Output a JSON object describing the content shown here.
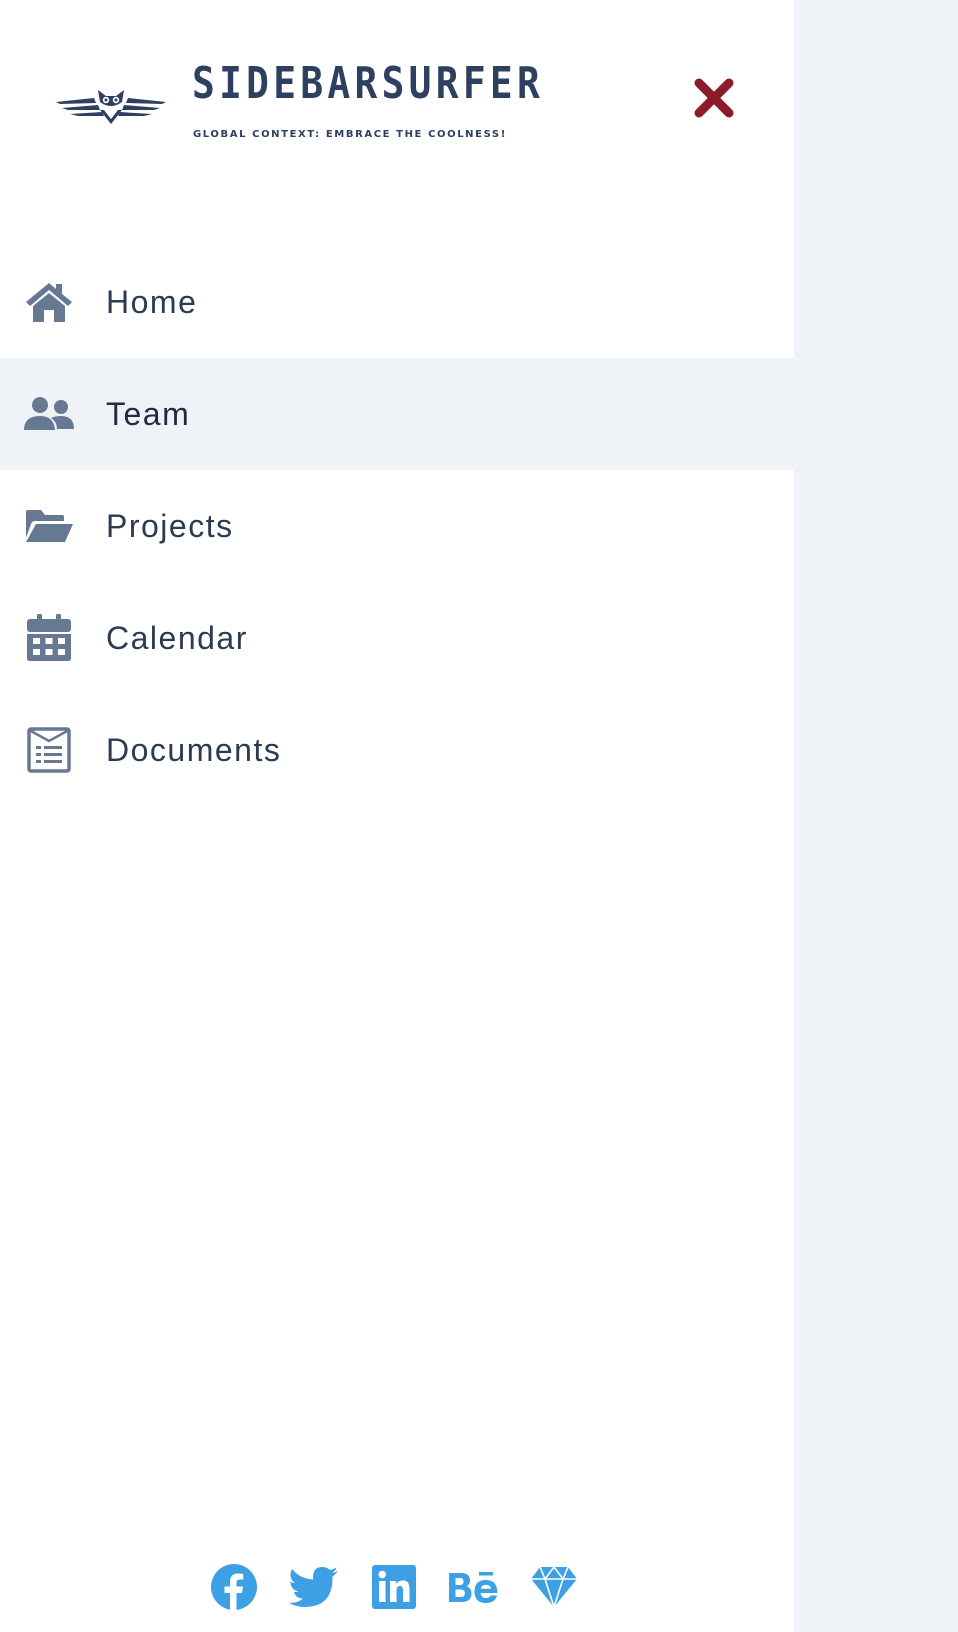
{
  "brand": {
    "name": "SIDEBARSURFER",
    "tagline": "GLOBAL CONTEXT: EMBRACE THE COOLNESS!",
    "logo_icon": "owl-wings-logo"
  },
  "close_icon": "close-icon",
  "nav": {
    "items": [
      {
        "label": "Home",
        "icon": "home-icon",
        "active": false
      },
      {
        "label": "Team",
        "icon": "users-icon",
        "active": true
      },
      {
        "label": "Projects",
        "icon": "folder-open-icon",
        "active": false
      },
      {
        "label": "Calendar",
        "icon": "calendar-icon",
        "active": false
      },
      {
        "label": "Documents",
        "icon": "document-icon",
        "active": false
      }
    ]
  },
  "social": [
    {
      "name": "facebook-icon"
    },
    {
      "name": "twitter-icon"
    },
    {
      "name": "linkedin-icon"
    },
    {
      "name": "behance-icon"
    },
    {
      "name": "sketch-icon"
    }
  ],
  "colors": {
    "text": "#2c3a52",
    "brand": "#2e4060",
    "icon": "#667892",
    "close": "#8b1a2b",
    "social": "#3ea0e4",
    "active_bg": "#eff3f8",
    "page_bg": "#eff3f8"
  }
}
